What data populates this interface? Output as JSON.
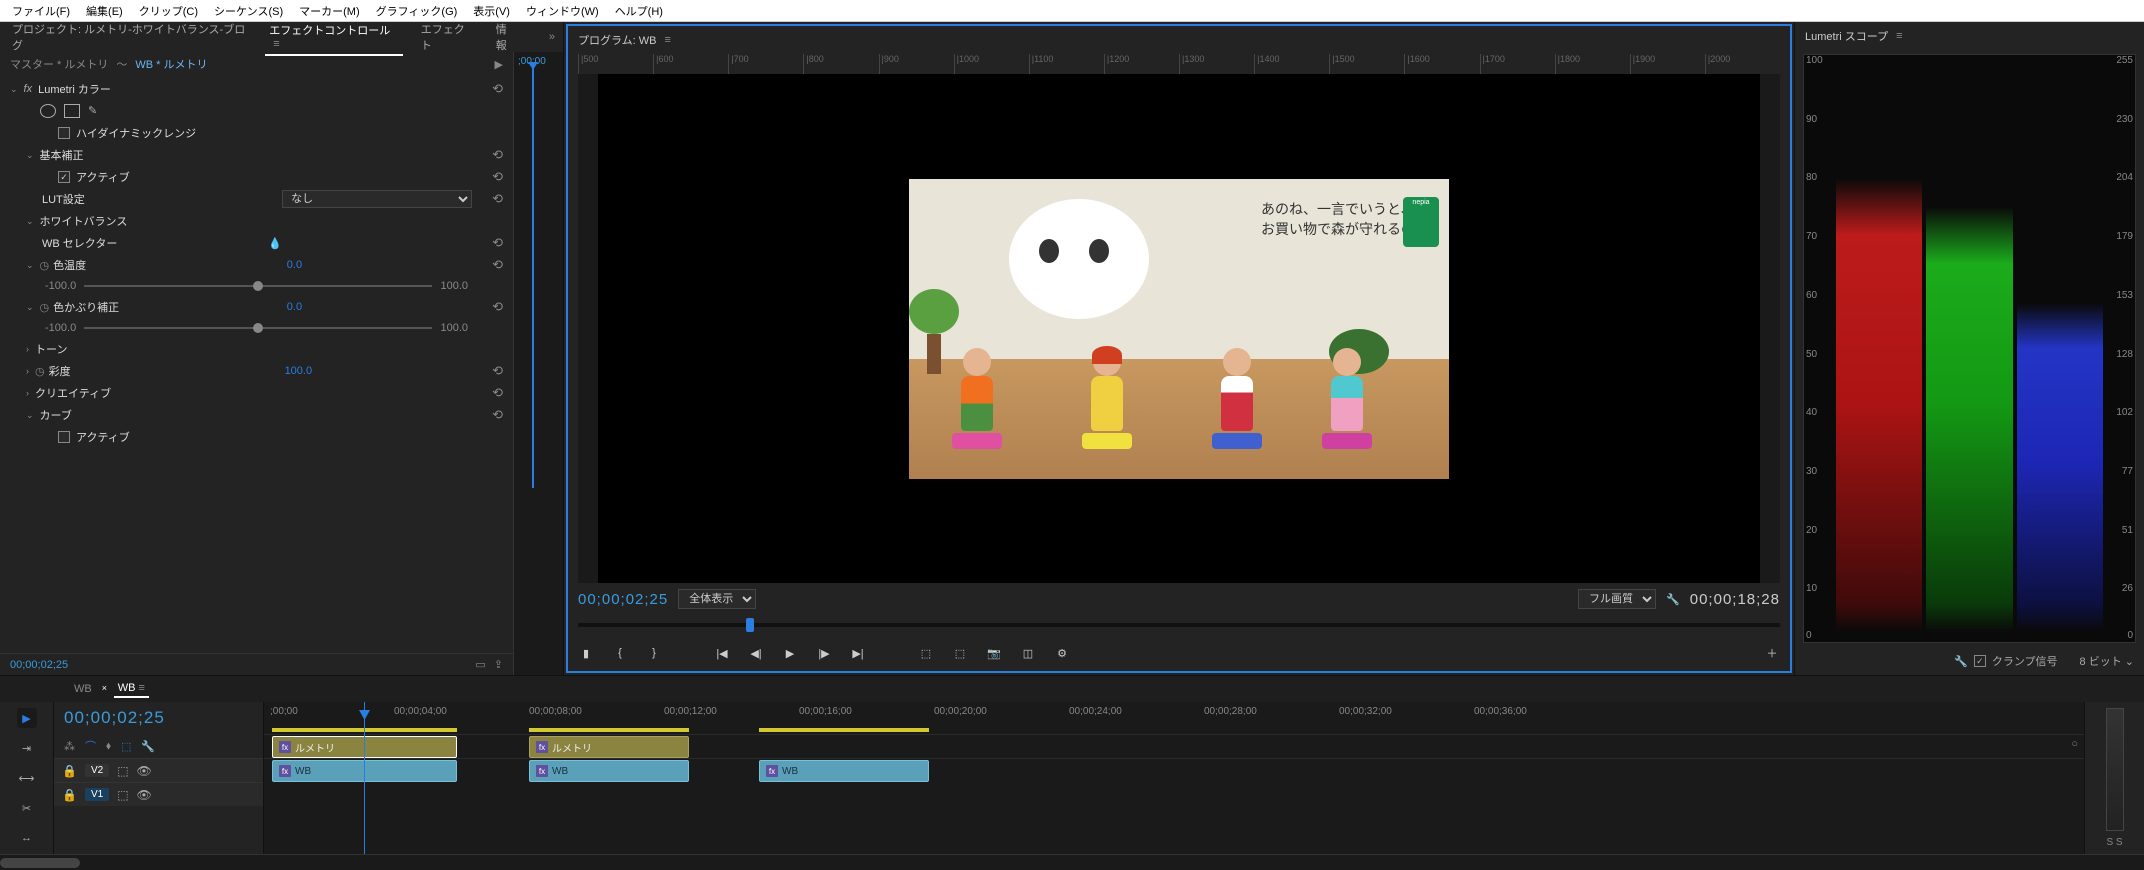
{
  "menu": [
    "ファイル(F)",
    "編集(E)",
    "クリップ(C)",
    "シーケンス(S)",
    "マーカー(M)",
    "グラフィック(G)",
    "表示(V)",
    "ウィンドウ(W)",
    "ヘルプ(H)"
  ],
  "leftPanel": {
    "projectLabel": "プロジェクト: ルメトリ-ホワイトバランス-ブログ",
    "tabs": {
      "effectControls": "エフェクトコントロール",
      "effects": "エフェクト",
      "info": "情報"
    },
    "breadcrumb": {
      "master": "マスター * ルメトリ",
      "active": "WB * ルメトリ"
    },
    "miniTc": ";00;00",
    "lumetri": {
      "title": "Lumetri カラー",
      "hdr": "ハイダイナミックレンジ",
      "basic": "基本補正",
      "active": "アクティブ",
      "lutLabel": "LUT設定",
      "lutValue": "なし",
      "wb": "ホワイトバランス",
      "wbSelector": "WB セレクター",
      "temp": "色温度",
      "tempVal": "0.0",
      "tint": "色かぶり補正",
      "tintVal": "0.0",
      "sliderMin": "-100.0",
      "sliderMax": "100.0",
      "tone": "トーン",
      "saturation": "彩度",
      "saturationVal": "100.0",
      "creative": "クリエイティブ",
      "curve": "カーブ",
      "active2": "アクティブ"
    },
    "bottomTc": "00;00;02;25"
  },
  "program": {
    "title": "プログラム: WB",
    "rulerH": [
      "|500",
      "|600",
      "|700",
      "|800",
      "|900",
      "|1000",
      "|1100",
      "|1200",
      "|1300",
      "|1400",
      "|1500",
      "|1600",
      "|1700",
      "|1800",
      "|1900",
      "|2000"
    ],
    "sceneText1": "あのね、一言でいうと、",
    "sceneText2": "お買い物で森が守れるの。",
    "nepia": "nepia",
    "tcLeft": "00;00;02;25",
    "fitLabel": "全体表示",
    "quality": "フル画質",
    "tcRight": "00;00;18;28"
  },
  "scopes": {
    "title": "Lumetri スコープ",
    "leftTicks": [
      100,
      90,
      80,
      70,
      60,
      50,
      40,
      30,
      20,
      10,
      0
    ],
    "rightTicks": [
      255,
      230,
      204,
      179,
      153,
      128,
      102,
      77,
      51,
      26,
      0
    ],
    "clampLabel": "クランプ信号",
    "bitLabel": "8 ビット"
  },
  "timeline": {
    "tabs": {
      "wb1": "WB",
      "wb2": "WB"
    },
    "tc": "00;00;02;25",
    "rulerTimes": [
      ";00;00",
      "00;00;04;00",
      "00;00;08;00",
      "00;00;12;00",
      "00;00;16;00",
      "00;00;20;00",
      "00;00;24;00",
      "00;00;28;00",
      "00;00;32;00",
      "00;00;36;00"
    ],
    "tracks": {
      "v2": "V2",
      "v1": "V1"
    },
    "clips": {
      "fx": "ルメトリ",
      "wb": "WB"
    },
    "audio": "S S"
  }
}
